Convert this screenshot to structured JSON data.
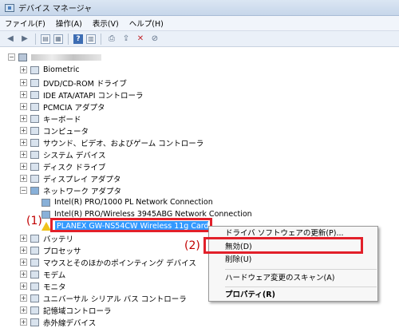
{
  "window": {
    "title": "デバイス マネージャ",
    "icon": "device-manager-icon"
  },
  "menu": [
    "ファイル(F)",
    "操作(A)",
    "表示(V)",
    "ヘルプ(H)"
  ],
  "toolbar": {
    "icons": [
      "back-arrow-icon",
      "forward-arrow-icon",
      "console-tree-icon",
      "properties-icon",
      "help-icon",
      "action-pane-icon",
      "scan-hardware-icon",
      "update-driver-icon",
      "uninstall-icon",
      "disable-icon"
    ]
  },
  "tree": {
    "root": {
      "expander": "−"
    },
    "categories": [
      {
        "label": "Biometric",
        "expander": "+"
      },
      {
        "label": "DVD/CD-ROM ドライブ",
        "expander": "+"
      },
      {
        "label": "IDE ATA/ATAPI コントローラ",
        "expander": "+"
      },
      {
        "label": "PCMCIA アダプタ",
        "expander": "+"
      },
      {
        "label": "キーボード",
        "expander": "+"
      },
      {
        "label": "コンピュータ",
        "expander": "+"
      },
      {
        "label": "サウンド、ビデオ、およびゲーム コントローラ",
        "expander": "+"
      },
      {
        "label": "システム デバイス",
        "expander": "+"
      },
      {
        "label": "ディスク ドライブ",
        "expander": "+"
      },
      {
        "label": "ディスプレイ アダプタ",
        "expander": "+"
      },
      {
        "label": "ネットワーク アダプタ",
        "expander": "−"
      }
    ],
    "network_children": [
      {
        "label": "Intel(R) PRO/1000 PL Network Connection"
      },
      {
        "label": "Intel(R) PRO/Wireless 3945ABG Network Connection"
      },
      {
        "label": "PLANEX GW-NS54CW Wireless 11g Cardbus",
        "selected": true
      }
    ],
    "after": [
      {
        "label": "バッテリ",
        "expander": "+"
      },
      {
        "label": "プロセッサ",
        "expander": "+"
      },
      {
        "label": "マウスとそのほかのポインティング デバイス",
        "expander": "+"
      },
      {
        "label": "モデム",
        "expander": "+"
      },
      {
        "label": "モニタ",
        "expander": "+"
      },
      {
        "label": "ユニバーサル シリアル バス コントローラ",
        "expander": "+"
      },
      {
        "label": "記憶域コントローラ",
        "expander": "+"
      },
      {
        "label": "赤外線デバイス",
        "expander": "+"
      }
    ]
  },
  "callouts": {
    "first": "(1)",
    "second": "(2)"
  },
  "context_menu": {
    "update_driver": "ドライバ ソフトウェアの更新(P)...",
    "disable": "無効(D)",
    "uninstall": "削除(U)",
    "scan": "ハードウェア変更のスキャン(A)",
    "properties": "プロパティ(R)"
  },
  "colors": {
    "selection": "#3399ff",
    "highlight_box": "#e2202a",
    "callout_text": "#c10000"
  }
}
